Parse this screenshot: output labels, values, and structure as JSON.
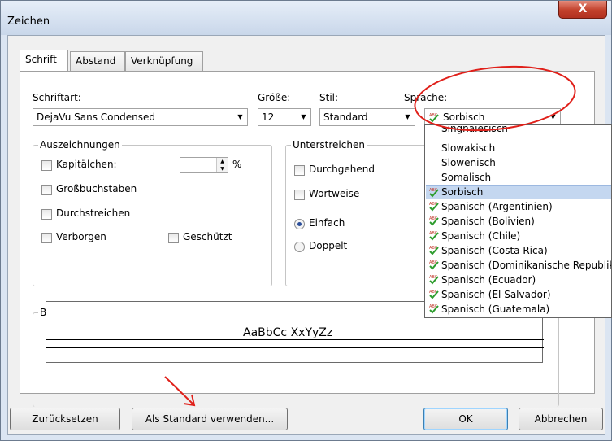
{
  "window": {
    "title": "Zeichen",
    "close": "X"
  },
  "tabs": [
    {
      "label": "Schrift",
      "active": true
    },
    {
      "label": "Abstand",
      "active": false
    },
    {
      "label": "Verknüpfung",
      "active": false
    }
  ],
  "font": {
    "family_label": "Schriftart:",
    "family_value": "DejaVu Sans Condensed",
    "size_label": "Größe:",
    "size_value": "12",
    "style_label": "Stil:",
    "style_value": "Standard",
    "language_label": "Sprache:",
    "language_value": "Sorbisch"
  },
  "auszeichnungen": {
    "title": "Auszeichnungen",
    "kapitaelchen": "Kapitälchen:",
    "percent": "%",
    "grossbuchstaben": "Großbuchstaben",
    "durchstreichen": "Durchstreichen",
    "verborgen": "Verborgen",
    "geschuetzt": "Geschützt"
  },
  "unterstreichen": {
    "title": "Unterstreichen",
    "durchgehend": "Durchgehend",
    "wortweise": "Wortweise",
    "einfach": "Einfach",
    "doppelt": "Doppelt"
  },
  "beispiel": {
    "title": "Beispiel",
    "sample": "AaBbCc XxYyZz"
  },
  "language_list": [
    {
      "label": "Singhalesisch",
      "check": false,
      "selected": false
    },
    {
      "label": "Slowakisch",
      "check": false,
      "selected": false
    },
    {
      "label": "Slowenisch",
      "check": false,
      "selected": false
    },
    {
      "label": "Somalisch",
      "check": false,
      "selected": false
    },
    {
      "label": "Sorbisch",
      "check": true,
      "selected": true
    },
    {
      "label": "Spanisch (Argentinien)",
      "check": true,
      "selected": false
    },
    {
      "label": "Spanisch (Bolivien)",
      "check": true,
      "selected": false
    },
    {
      "label": "Spanisch (Chile)",
      "check": true,
      "selected": false
    },
    {
      "label": "Spanisch (Costa Rica)",
      "check": true,
      "selected": false
    },
    {
      "label": "Spanisch (Dominikanische Republik)",
      "check": true,
      "selected": false
    },
    {
      "label": "Spanisch (Ecuador)",
      "check": true,
      "selected": false
    },
    {
      "label": "Spanisch (El Salvador)",
      "check": true,
      "selected": false
    },
    {
      "label": "Spanisch (Guatemala)",
      "check": true,
      "selected": false
    }
  ],
  "buttons": {
    "reset": "Zurücksetzen",
    "default": "Als Standard verwenden...",
    "ok": "OK",
    "cancel": "Abbrechen"
  },
  "colors": {
    "annotation": "#e0201a",
    "checkmark": "#2d9c2d",
    "selection": "#c4d7f0"
  }
}
